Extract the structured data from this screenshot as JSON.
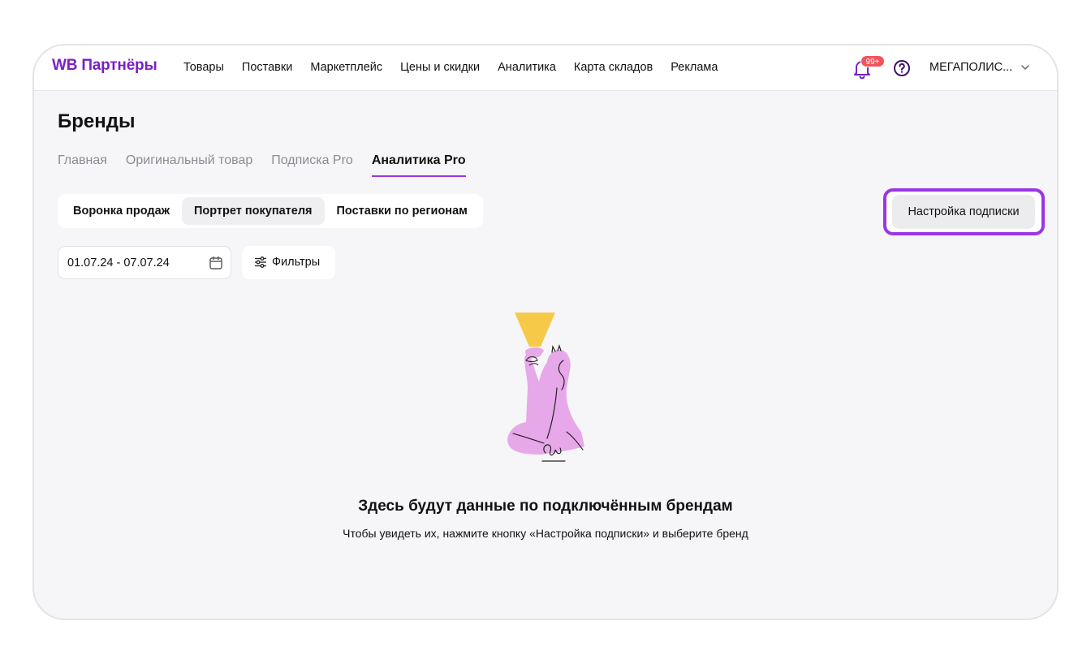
{
  "header": {
    "logo": "WB Партнёры",
    "nav": [
      "Товары",
      "Поставки",
      "Маркетплейс",
      "Цены и скидки",
      "Аналитика",
      "Карта складов",
      "Реклама"
    ],
    "notifications_badge": "99+",
    "account": "МЕГАПОЛИС...",
    "icons": [
      "bell-icon",
      "help-icon",
      "chevron-down-icon"
    ]
  },
  "page": {
    "title": "Бренды",
    "tabs": [
      "Главная",
      "Оригинальный товар",
      "Подписка Pro",
      "Аналитика Pro"
    ],
    "active_tab": "Аналитика Pro"
  },
  "subnav": {
    "items": [
      "Воронка продаж",
      "Портрет покупателя",
      "Поставки по регионам"
    ],
    "active": "Портрет покупателя"
  },
  "subscription_button": "Настройка подписки",
  "filters": {
    "date_range": "01.07.24 - 07.07.24",
    "filter_label": "Фильтры"
  },
  "empty_state": {
    "title": "Здесь будут данные по подключённым брендам",
    "subtitle": "Чтобы увидеть их, нажмите кнопку «Настройка подписки» и выберите бренд"
  },
  "colors": {
    "brand": "#7a1fc7",
    "accent": "#9b35e6",
    "badge": "#f2535c",
    "figure": "#e7a8ea",
    "lamp": "#f7c948"
  }
}
